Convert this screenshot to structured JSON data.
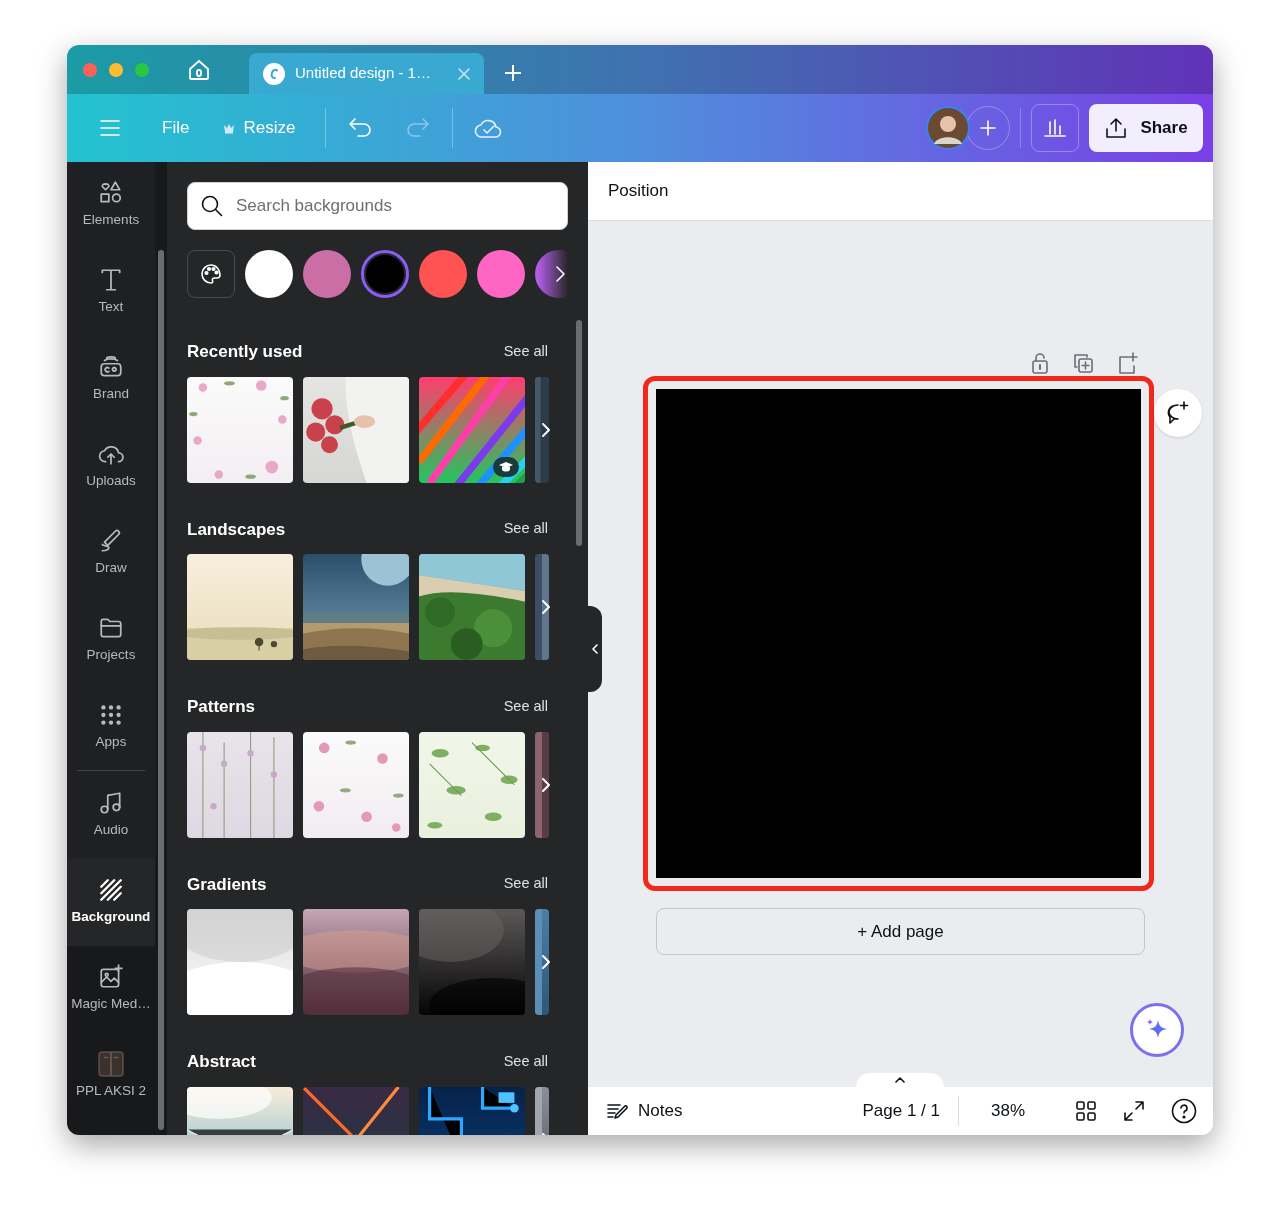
{
  "browser_tabs": [
    {
      "title": "Untitled design - 1…",
      "selected": true
    }
  ],
  "toolbar": {
    "file": "File",
    "resize": "Resize",
    "undo_enabled": true,
    "redo_enabled": false,
    "share": "Share"
  },
  "rail": [
    {
      "label": "Elements",
      "kind": "elements",
      "selected": false
    },
    {
      "label": "Text",
      "kind": "text",
      "selected": false
    },
    {
      "label": "Brand",
      "kind": "brand",
      "selected": false
    },
    {
      "label": "Uploads",
      "kind": "uploads",
      "selected": false
    },
    {
      "label": "Draw",
      "kind": "draw",
      "selected": false
    },
    {
      "label": "Projects",
      "kind": "projects",
      "selected": false
    },
    {
      "label": "Apps",
      "kind": "apps",
      "selected": false
    },
    {
      "label": "Audio",
      "kind": "audio",
      "selected": false
    },
    {
      "label": "Background",
      "kind": "background",
      "selected": true
    },
    {
      "label": "Magic Med…",
      "kind": "magic",
      "selected": false
    },
    {
      "label": "PPL AKSI 2",
      "kind": "folder",
      "selected": false
    }
  ],
  "panel": {
    "search": {
      "placeholder": "Search backgrounds"
    },
    "swatches": [
      {
        "color": "#ffffff",
        "selected": false
      },
      {
        "color": "#cc6ea6",
        "selected": false
      },
      {
        "color": "#000000",
        "selected": true
      },
      {
        "color": "#ff5252",
        "selected": false
      },
      {
        "color": "#ff66c4",
        "selected": false
      },
      {
        "color": "#b55ee8",
        "selected": false
      }
    ],
    "sections": [
      {
        "title": "Recently used",
        "see_all": "See all",
        "thumbnails": [
          {
            "kind": "picture"
          },
          {
            "kind": "picture"
          },
          {
            "kind": "picture",
            "education": true
          },
          {
            "kind": "picture"
          }
        ]
      },
      {
        "title": "Landscapes",
        "see_all": "See all",
        "thumbnails": [
          {
            "kind": "picture"
          },
          {
            "kind": "picture"
          },
          {
            "kind": "picture"
          },
          {
            "kind": "picture"
          }
        ]
      },
      {
        "title": "Patterns",
        "see_all": "See all",
        "thumbnails": [
          {
            "kind": "picture"
          },
          {
            "kind": "picture"
          },
          {
            "kind": "picture"
          },
          {
            "kind": "picture"
          }
        ]
      },
      {
        "title": "Gradients",
        "see_all": "See all",
        "thumbnails": [
          {
            "kind": "picture"
          },
          {
            "kind": "picture"
          },
          {
            "kind": "picture"
          },
          {
            "kind": "picture"
          }
        ]
      },
      {
        "title": "Abstract",
        "see_all": "See all",
        "thumbnails": [
          {
            "kind": "picture"
          },
          {
            "kind": "picture"
          },
          {
            "kind": "picture"
          },
          {
            "kind": "picture"
          }
        ]
      }
    ]
  },
  "editor": {
    "header": "Position",
    "page_selected": true,
    "add_page": "+ Add page"
  },
  "footer": {
    "notes": "Notes",
    "page": "Page 1 / 1",
    "zoom": "38%"
  }
}
